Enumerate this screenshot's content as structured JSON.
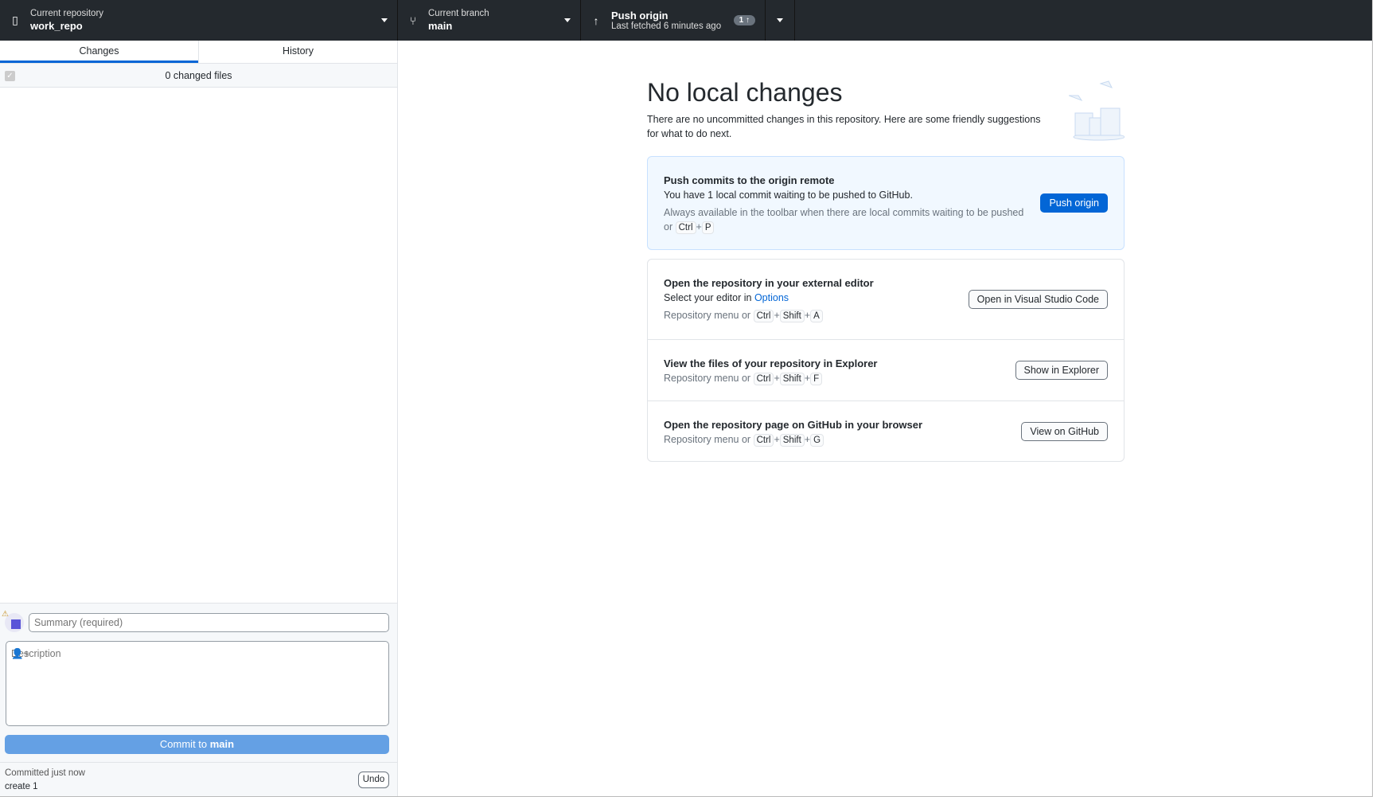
{
  "toolbar": {
    "repo": {
      "label": "Current repository",
      "value": "work_repo"
    },
    "branch": {
      "label": "Current branch",
      "value": "main"
    },
    "push": {
      "label": "Push origin",
      "sub": "Last fetched 6 minutes ago",
      "badge": "1 ↑"
    }
  },
  "sidebar": {
    "tabs": [
      {
        "label": "Changes"
      },
      {
        "label": "History"
      }
    ],
    "changed_files": "0 changed files",
    "commit": {
      "summary_placeholder": "Summary (required)",
      "description_placeholder": "Description",
      "button_prefix": "Commit to ",
      "button_branch": "main"
    },
    "last_commit": {
      "status": "Committed just now",
      "message": "create 1",
      "undo": "Undo"
    }
  },
  "main": {
    "title": "No local changes",
    "intro": "There are no uncommitted changes in this repository. Here are some friendly suggestions for what to do next.",
    "push_card": {
      "title": "Push commits to the origin remote",
      "sub": "You have 1 local commit waiting to be pushed to GitHub.",
      "hint": "Always available in the toolbar when there are local commits waiting to be pushed or",
      "keys": [
        "Ctrl",
        "P"
      ],
      "button": "Push origin"
    },
    "actions": [
      {
        "title": "Open the repository in your external editor",
        "sub": "Select your editor in ",
        "link": "Options",
        "hint": "Repository menu or",
        "keys": [
          "Ctrl",
          "Shift",
          "A"
        ],
        "button": "Open in Visual Studio Code"
      },
      {
        "title": "View the files of your repository in Explorer",
        "hint": "Repository menu or",
        "keys": [
          "Ctrl",
          "Shift",
          "F"
        ],
        "button": "Show in Explorer"
      },
      {
        "title": "Open the repository page on GitHub in your browser",
        "hint": "Repository menu or",
        "keys": [
          "Ctrl",
          "Shift",
          "G"
        ],
        "button": "View on GitHub"
      }
    ],
    "plus": "+"
  },
  "colors": {
    "toolbar": "#24292e",
    "accent": "#0366d6",
    "commit_button": "#64a0e4"
  }
}
